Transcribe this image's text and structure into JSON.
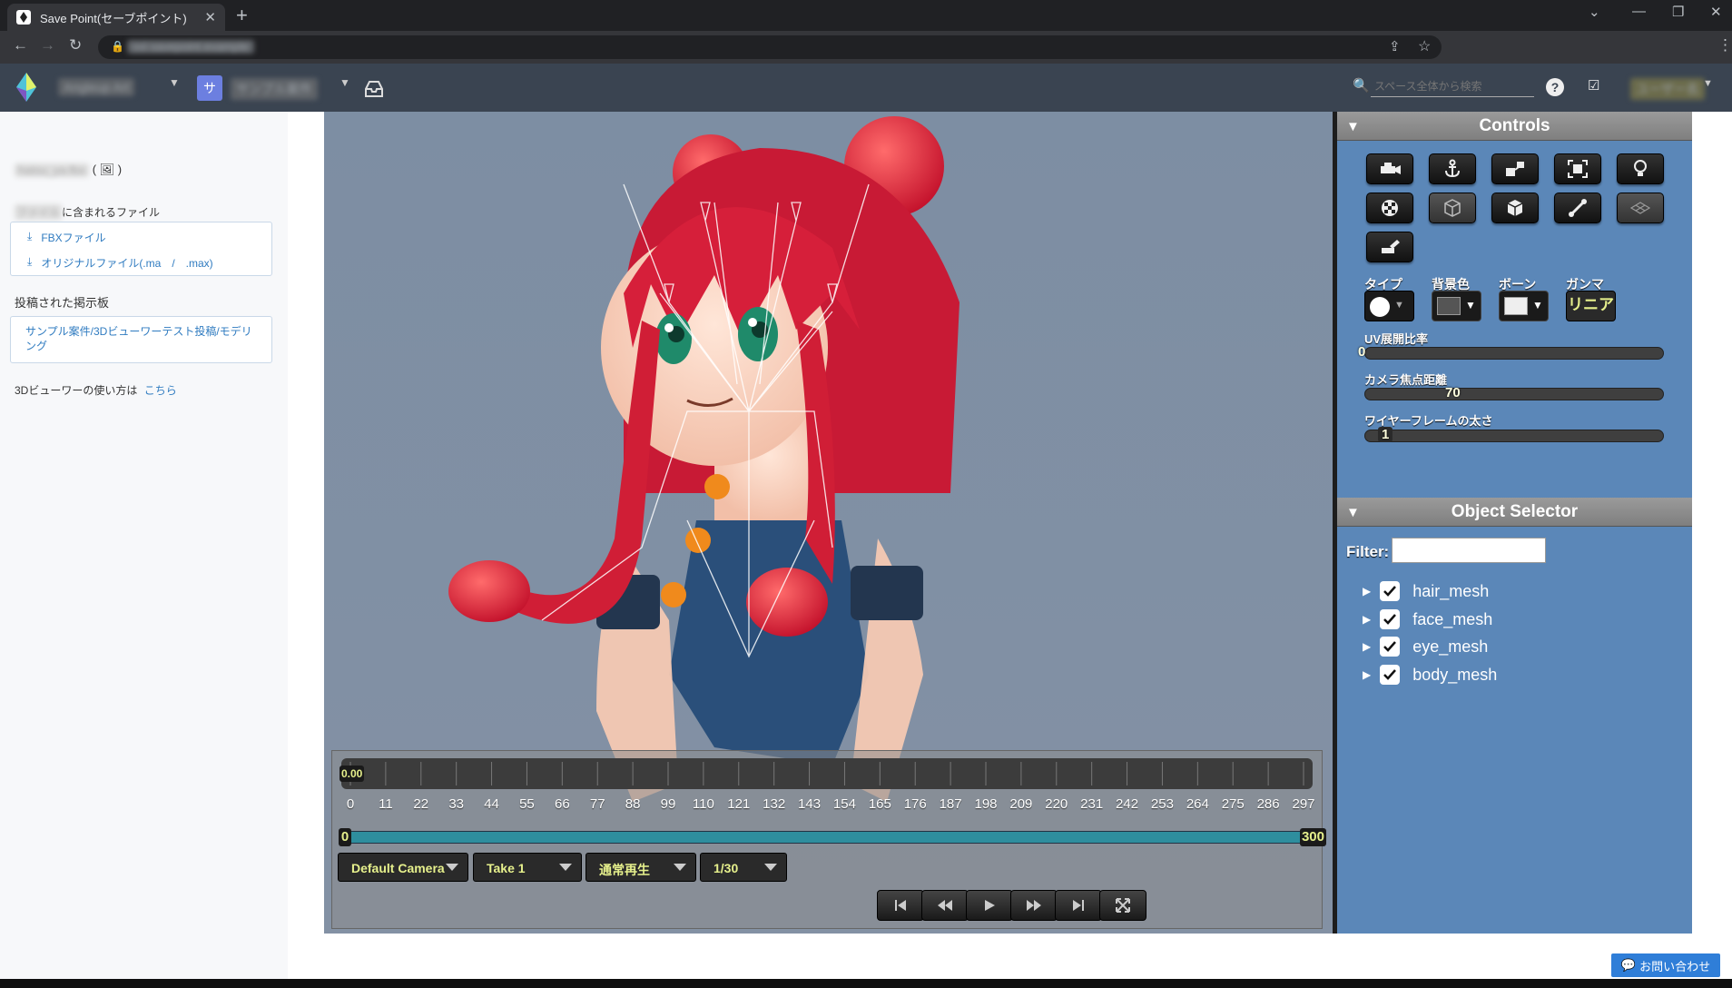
{
  "browser": {
    "tab_title": "Save Point(セーブポイント)",
    "new_tab": "+",
    "close": "✕",
    "url": "ssl.savepoint.example"
  },
  "header": {
    "org": "Angleup Art",
    "space_initial": "サ",
    "space": "サンプル案件",
    "search_placeholder": "スペース全体から検索",
    "user": "ユーザー名"
  },
  "sidebar": {
    "file_name": "hatsu_ya.fbx",
    "file_tag": "( 🖼 )",
    "included_prefix": "ファイル",
    "included_label": "に含まれるファイル",
    "files": [
      "FBXファイル",
      "オリジナルファイル(.ma　/　.max)"
    ],
    "posted_board_label": "投稿された掲示板",
    "board_link": "サンプル案件/3Dビューワーテスト投稿/モデリング",
    "howto_text": "3Dビューワーの使い方は",
    "howto_link": "こちら"
  },
  "controls": {
    "title": "Controls",
    "type_label": "タイプ",
    "bg_label": "背景色",
    "bone_label": "ボーン",
    "gamma_label": "ガンマ",
    "gamma_value": "リニア",
    "uv_label": "UV展開比率",
    "uv_value": "0",
    "focus_label": "カメラ焦点距離",
    "focus_value": "70",
    "wire_label": "ワイヤーフレームの太さ",
    "wire_value": "1"
  },
  "object_selector": {
    "title": "Object Selector",
    "filter_label": "Filter:",
    "filter_value": "",
    "objects": [
      "hair_mesh",
      "face_mesh",
      "eye_mesh",
      "body_mesh"
    ]
  },
  "timeline": {
    "current": "0.00",
    "ticks": [
      "0",
      "11",
      "22",
      "33",
      "44",
      "55",
      "66",
      "77",
      "88",
      "99",
      "110",
      "121",
      "132",
      "143",
      "154",
      "165",
      "176",
      "187",
      "198",
      "209",
      "220",
      "231",
      "242",
      "253",
      "264",
      "275",
      "286",
      "297"
    ],
    "range_start": "0",
    "range_end": "300",
    "camera": "Default Camera",
    "take": "Take 1",
    "playback": "通常再生",
    "fps": "1/30"
  },
  "footer": {
    "contact": "お問い合わせ"
  }
}
